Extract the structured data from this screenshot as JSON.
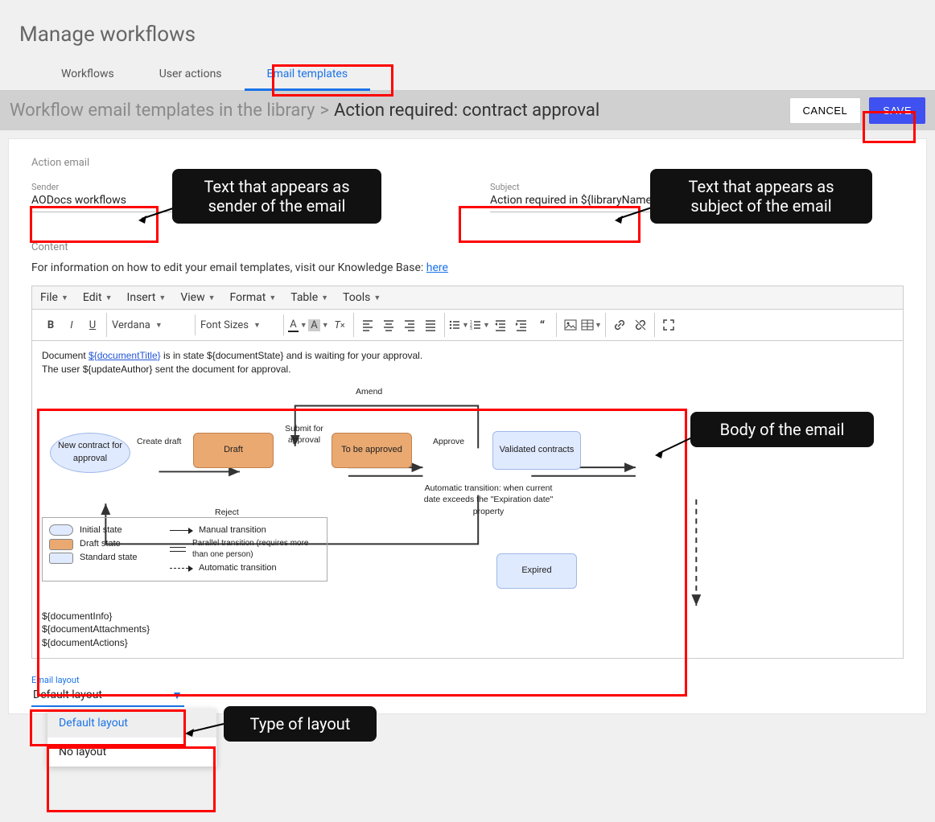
{
  "page_title": "Manage workflows",
  "tabs": [
    "Workflows",
    "User actions",
    "Email templates"
  ],
  "active_tab_index": 2,
  "breadcrumb": {
    "root": "Workflow email templates in the library",
    "sep": ">",
    "current": "Action required: contract approval"
  },
  "buttons": {
    "cancel": "CANCEL",
    "save": "SAVE"
  },
  "section_label": "Action email",
  "fields": {
    "sender": {
      "label": "Sender",
      "value": "AODocs workflows"
    },
    "subject": {
      "label": "Subject",
      "value": "Action required in ${libraryName}"
    }
  },
  "content_label": "Content",
  "help_text": "For information on how to edit your email templates, visit our Knowledge Base: ",
  "help_link": "here",
  "editor": {
    "menus": [
      "File",
      "Edit",
      "Insert",
      "View",
      "Format",
      "Table",
      "Tools"
    ],
    "font_family": "Verdana",
    "font_size": "Font Sizes",
    "body_line1_prefix": "Document ",
    "body_line1_link": "${documentTitle}",
    "body_line1_suffix": " is in state ${documentState} and is waiting for your approval.",
    "body_line2": "The user ${updateAuthor} sent the document for approval.",
    "body_vars": [
      "${documentInfo}",
      "${documentAttachments}",
      "${documentActions}"
    ]
  },
  "diagram": {
    "nodes": {
      "new_contract": "New contract for approval",
      "draft": "Draft",
      "to_be_approved": "To be approved",
      "validated": "Validated contracts",
      "expired": "Expired"
    },
    "edges": {
      "create_draft": "Create draft",
      "submit": "Submit for approval",
      "approve": "Approve",
      "amend": "Amend",
      "reject": "Reject"
    },
    "auto_transition": "Automatic transition: when current date exceeds the \"Expiration date\" property",
    "legend": {
      "initial": "Initial state",
      "draft": "Draft state",
      "standard": "Standard state",
      "manual": "Manual transition",
      "parallel": "Parallel transition (requires more than one person)",
      "automatic": "Automatic transition"
    }
  },
  "layout": {
    "label": "Email layout",
    "value": "Default layout",
    "options": [
      "Default layout",
      "No layout"
    ]
  },
  "callouts": {
    "sender": "Text that appears as sender of the email",
    "subject": "Text that appears as subject of the email",
    "body": "Body of the email",
    "layout": "Type of layout"
  }
}
